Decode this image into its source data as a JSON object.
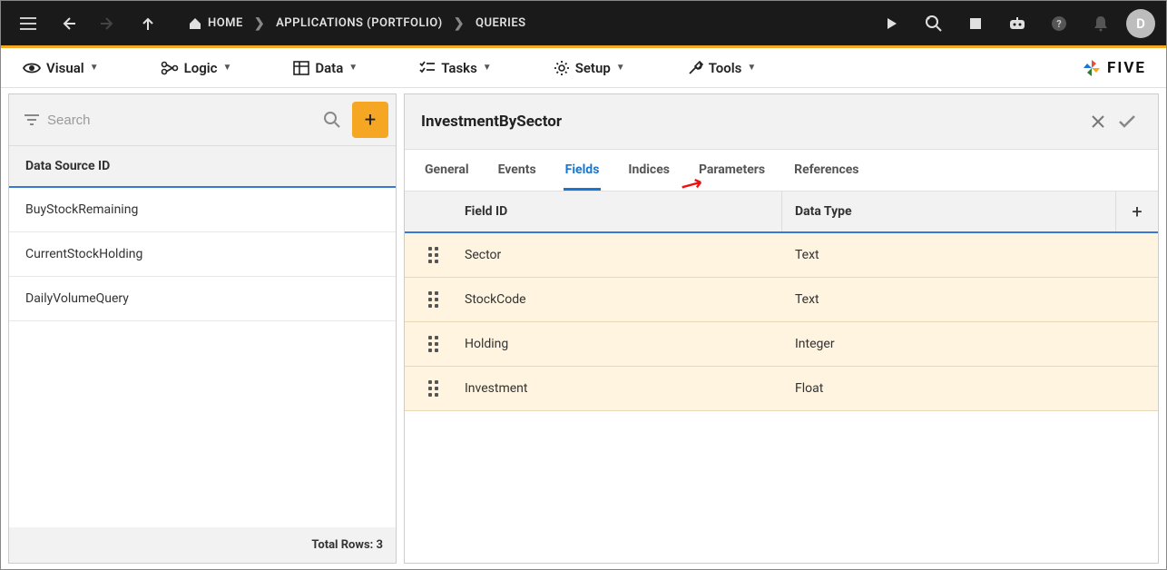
{
  "topbar": {
    "home_label": "HOME",
    "bc2_label": "APPLICATIONS (PORTFOLIO)",
    "bc3_label": "QUERIES",
    "avatar_letter": "D"
  },
  "menubar": {
    "visual": "Visual",
    "logic": "Logic",
    "data": "Data",
    "tasks": "Tasks",
    "setup": "Setup",
    "tools": "Tools",
    "brand": "FIVE"
  },
  "left": {
    "search_placeholder": "Search",
    "col_header": "Data Source ID",
    "rows": [
      "BuyStockRemaining",
      "CurrentStockHolding",
      "DailyVolumeQuery"
    ],
    "footer_label": "Total Rows:",
    "footer_count": "3"
  },
  "right": {
    "title": "InvestmentBySector",
    "tabs": {
      "general": "General",
      "events": "Events",
      "fields": "Fields",
      "indices": "Indices",
      "parameters": "Parameters",
      "references": "References"
    },
    "thead": {
      "field": "Field ID",
      "type": "Data Type"
    },
    "rows": [
      {
        "field": "Sector",
        "type": "Text"
      },
      {
        "field": "StockCode",
        "type": "Text"
      },
      {
        "field": "Holding",
        "type": "Integer"
      },
      {
        "field": "Investment",
        "type": "Float"
      }
    ]
  }
}
